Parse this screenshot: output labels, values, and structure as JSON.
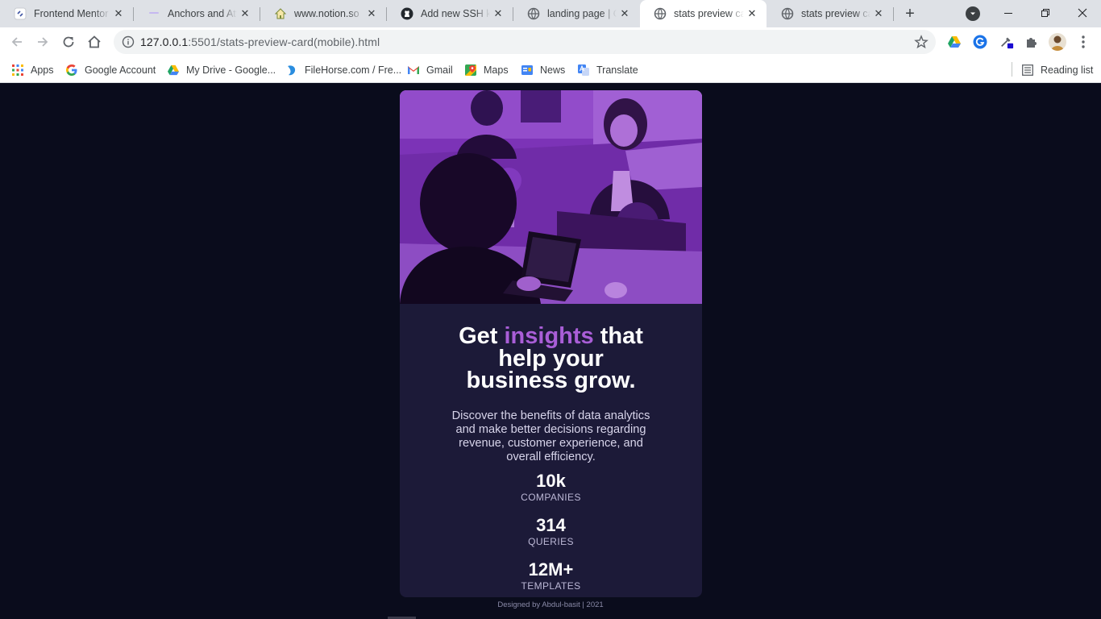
{
  "browser": {
    "tabs": [
      {
        "title": "Frontend Mentor",
        "icon": "frontend-mentor-icon",
        "active": false
      },
      {
        "title": "Anchors and Attributes",
        "icon": "doc-icon",
        "active": false
      },
      {
        "title": "www.notion.so",
        "icon": "notion-house-icon",
        "active": false
      },
      {
        "title": "Add new SSH key",
        "icon": "github-icon",
        "active": false
      },
      {
        "title": "landing page | OS",
        "icon": "globe-icon",
        "active": false
      },
      {
        "title": "stats preview card",
        "icon": "globe-icon",
        "active": true
      },
      {
        "title": "stats preview card",
        "icon": "globe-icon",
        "active": false
      }
    ],
    "url_host": "127.0.0.1",
    "url_rest": ":5501/stats-preview-card(mobile).html",
    "bookmarks": [
      {
        "label": "Apps",
        "icon": "apps-grid-icon"
      },
      {
        "label": "Google Account",
        "icon": "google-icon"
      },
      {
        "label": "My Drive - Google...",
        "icon": "drive-icon"
      },
      {
        "label": "FileHorse.com / Fre...",
        "icon": "filehorse-icon"
      },
      {
        "label": "Gmail",
        "icon": "gmail-icon"
      },
      {
        "label": "Maps",
        "icon": "maps-icon"
      },
      {
        "label": "News",
        "icon": "news-icon"
      },
      {
        "label": "Translate",
        "icon": "translate-icon"
      }
    ],
    "reading_list": "Reading list"
  },
  "card": {
    "headline_pre": "Get ",
    "headline_accent": "insights",
    "headline_post": " that help your business grow.",
    "description": "Discover the benefits of data analytics and make better decisions regarding revenue, customer experience, and overall efficiency.",
    "stats": [
      {
        "value": "10k",
        "label": "COMPANIES"
      },
      {
        "value": "314",
        "label": "QUERIES"
      },
      {
        "value": "12M+",
        "label": "TEMPLATES"
      }
    ]
  },
  "footer": "Designed by Abdul-basit | 2021",
  "colors": {
    "page_bg": "#0a0c1c",
    "card_bg": "#1c1a38",
    "accent": "#a95ed7"
  }
}
